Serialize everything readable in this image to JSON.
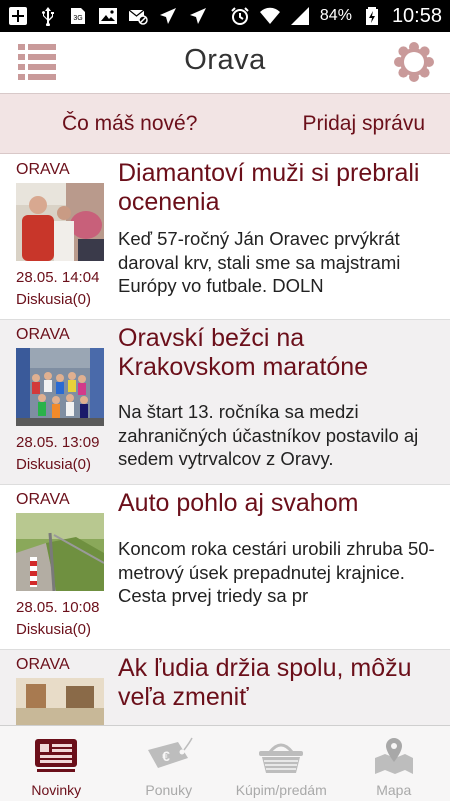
{
  "status_bar": {
    "battery_percent": "84%",
    "time": "10:58",
    "sim_label": "3G"
  },
  "app_bar": {
    "title": "Orava"
  },
  "actions": {
    "whats_new": "Čo máš nové?",
    "add_message": "Pridaj správu"
  },
  "news": [
    {
      "region": "ORAVA",
      "headline": "Diamantoví muži si prebrali ocenenia",
      "excerpt": "Keď 57-ročný Ján Oravec prvýkrát daroval krv, stali sme sa majstrami Európy vo futbale.  DOLN",
      "date": "28.05. 14:04",
      "discussion": "Diskusia(0)"
    },
    {
      "region": "ORAVA",
      "headline": "Oravskí bežci na Krakovskom maratóne",
      "excerpt": "Na štart 13. ročníka sa medzi zahraničných účastníkov postavilo aj sedem vytrvalcov z Oravy.",
      "date": "28.05. 13:09",
      "discussion": "Diskusia(0)"
    },
    {
      "region": "ORAVA",
      "headline": "Auto pohlo aj svahom",
      "excerpt": "Koncom roka cestári urobili zhruba 50-metrový úsek prepadnutej krajnice. Cesta prvej triedy sa pr",
      "date": "28.05. 10:08",
      "discussion": "Diskusia(0)"
    },
    {
      "region": "ORAVA",
      "headline": "Ak ľudia držia spolu, môžu veľa zmeniť"
    }
  ],
  "bottom_nav": [
    {
      "label": "Novinky",
      "icon": "newspaper-icon",
      "active": true
    },
    {
      "label": "Ponuky",
      "icon": "price-tag-icon",
      "active": false
    },
    {
      "label": "Kúpim/predám",
      "icon": "basket-icon",
      "active": false
    },
    {
      "label": "Mapa",
      "icon": "map-pin-icon",
      "active": false
    }
  ],
  "colors": {
    "accent": "#6b0f1a",
    "action_bar_bg": "#f2e4e4",
    "menu_icon": "#c99a9a",
    "inactive_nav": "#a9a9a9"
  }
}
